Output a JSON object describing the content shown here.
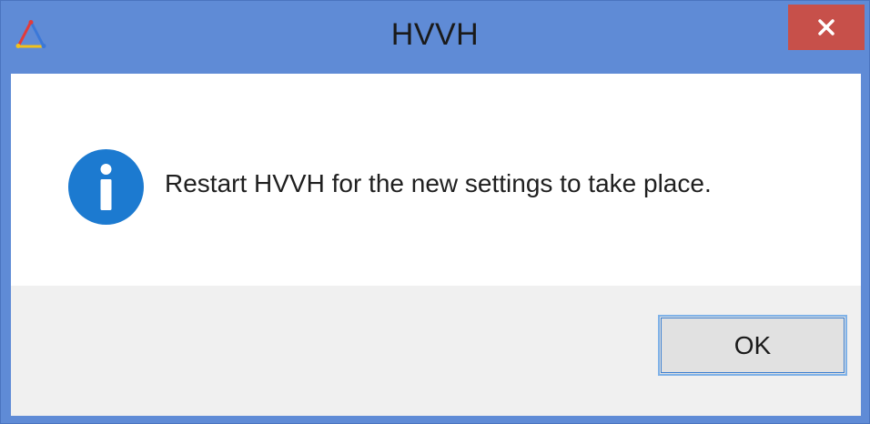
{
  "window": {
    "title": "HVVH",
    "app_icon": "tricolor-triangle-app-icon",
    "close_icon": "close-x-icon",
    "colors": {
      "titlebar": "#5f8bd6",
      "close_button": "#c7504a",
      "footer": "#f0f0f0"
    }
  },
  "dialog": {
    "icon": "info-icon",
    "icon_color": "#1c7ad0",
    "message": "Restart HVVH for the new settings to take place."
  },
  "buttons": {
    "ok_label": "OK"
  }
}
